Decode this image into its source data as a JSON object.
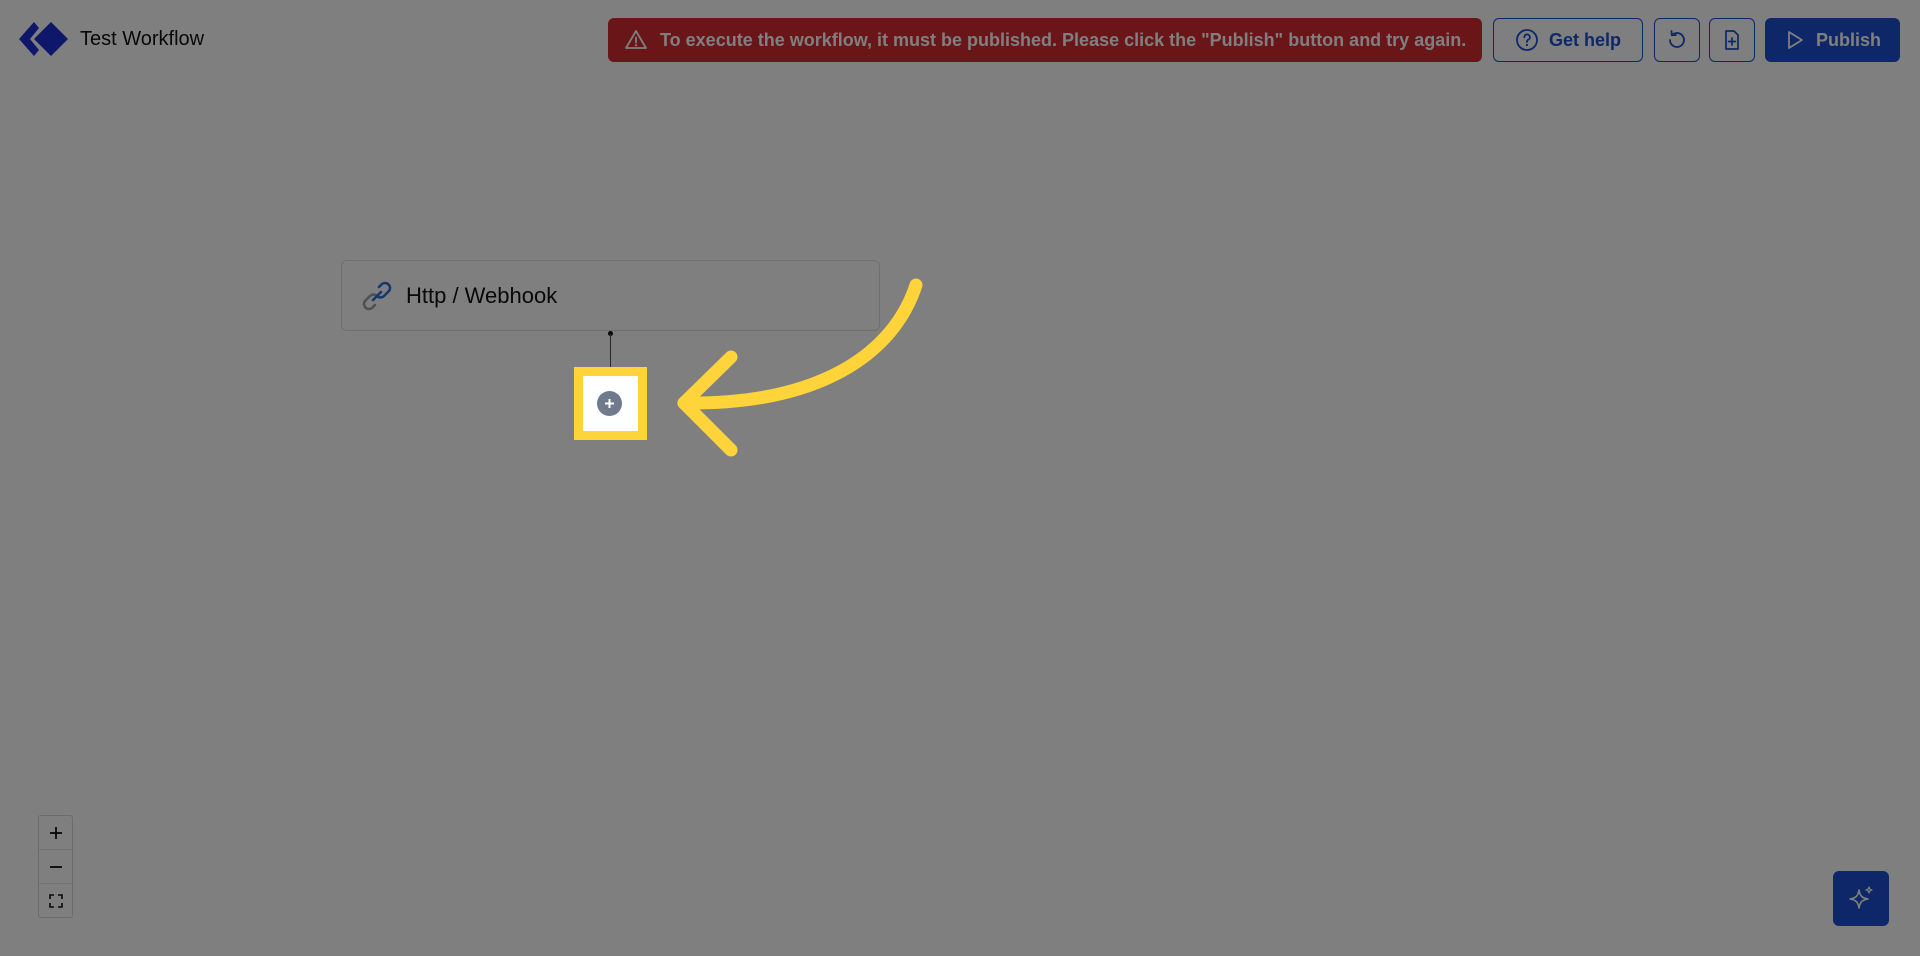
{
  "header": {
    "title": "Test Workflow",
    "error_message": "To execute the workflow, it must be published. Please click the \"Publish\" button and try again.",
    "help_label": "Get help",
    "publish_label": "Publish"
  },
  "icons": {
    "logo": "chevron-diamond-logo",
    "warning": "warning-triangle-icon",
    "help": "question-circle-icon",
    "history": "history-icon",
    "file": "file-add-icon",
    "publish": "play-icon",
    "link": "link-icon",
    "add": "plus-icon",
    "zoom_in": "plus-icon",
    "zoom_out": "minus-icon",
    "fit": "fit-view-icon",
    "ai": "sparkles-icon"
  },
  "canvas": {
    "node_label": "Http / Webhook"
  },
  "colors": {
    "primary": "#1a4fd1",
    "error": "#d42a31",
    "highlight": "#ffd43b",
    "overlay": "rgba(0,0,0,0.5)"
  }
}
